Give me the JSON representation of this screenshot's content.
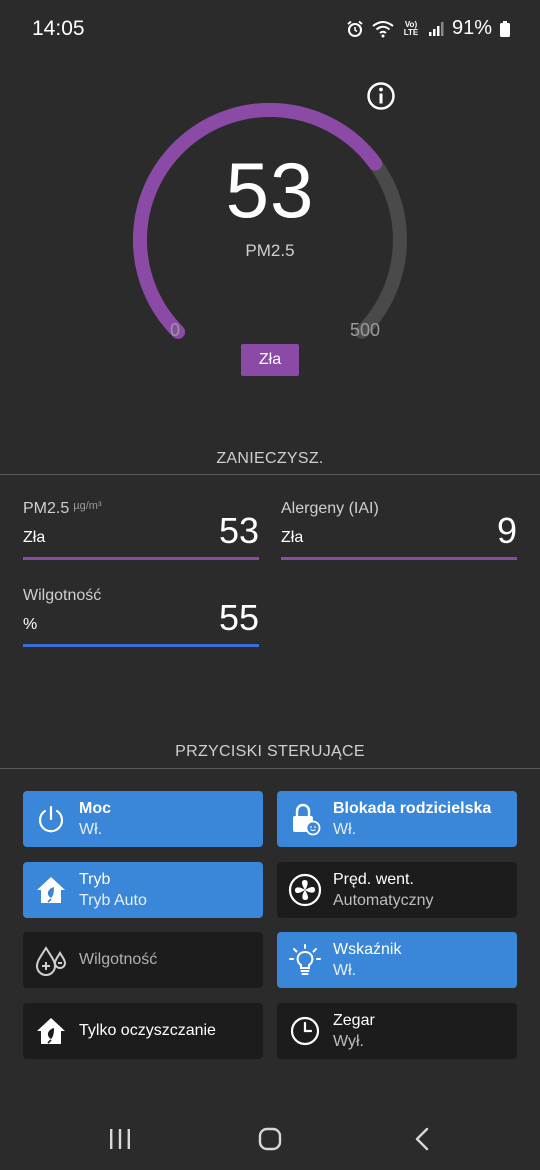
{
  "status_bar": {
    "time": "14:05",
    "battery": "91%",
    "network_label": "Vo) LTE"
  },
  "gauge": {
    "value": "53",
    "pollutant": "PM2.5",
    "min": "0",
    "max": "500",
    "quality": "Zła",
    "fraction": 0.7,
    "accent_color": "#8b4aa5",
    "track_color": "#4a4a4a"
  },
  "pollutants": {
    "title": "ZANIECZYSZ.",
    "metrics": [
      {
        "name": "PM2.5",
        "unit": "µg/m³",
        "sub": "Zła",
        "value": "53",
        "line_color": "#8b4aa5"
      },
      {
        "name": "Alergeny (IAI)",
        "unit": "",
        "sub": "Zła",
        "value": "9",
        "line_color": "#8b4aa5"
      },
      {
        "name": "Wilgotność",
        "unit": "",
        "sub": "%",
        "value": "55",
        "line_color": "#3a6fd8"
      }
    ]
  },
  "controls": {
    "title": "PRZYCISKI STERUJĄCE",
    "buttons": [
      {
        "label": "Moc",
        "state": "Wł.",
        "icon": "power-icon",
        "active": true
      },
      {
        "label": "Blokada rodzicielska",
        "state": "Wł.",
        "icon": "child-lock-icon",
        "active": true
      },
      {
        "label": "Tryb",
        "state": "Tryb Auto",
        "icon": "mode-house-icon",
        "active": true
      },
      {
        "label": "Pręd. went.",
        "state": "Automatyczny",
        "icon": "fan-icon",
        "active": false
      },
      {
        "label": "Wilgotność",
        "state": "",
        "icon": "humidity-drops-icon",
        "active": false
      },
      {
        "label": "Wskaźnik",
        "state": "Wł.",
        "icon": "light-bulb-icon",
        "active": true
      },
      {
        "label": "Tylko oczyszczanie",
        "state": "",
        "icon": "purify-house-icon",
        "active": false
      },
      {
        "label": "Zegar",
        "state": "Wył.",
        "icon": "clock-icon",
        "active": false
      }
    ]
  },
  "nav": {
    "recents": "recents-icon",
    "home": "home-icon",
    "back": "back-icon"
  }
}
